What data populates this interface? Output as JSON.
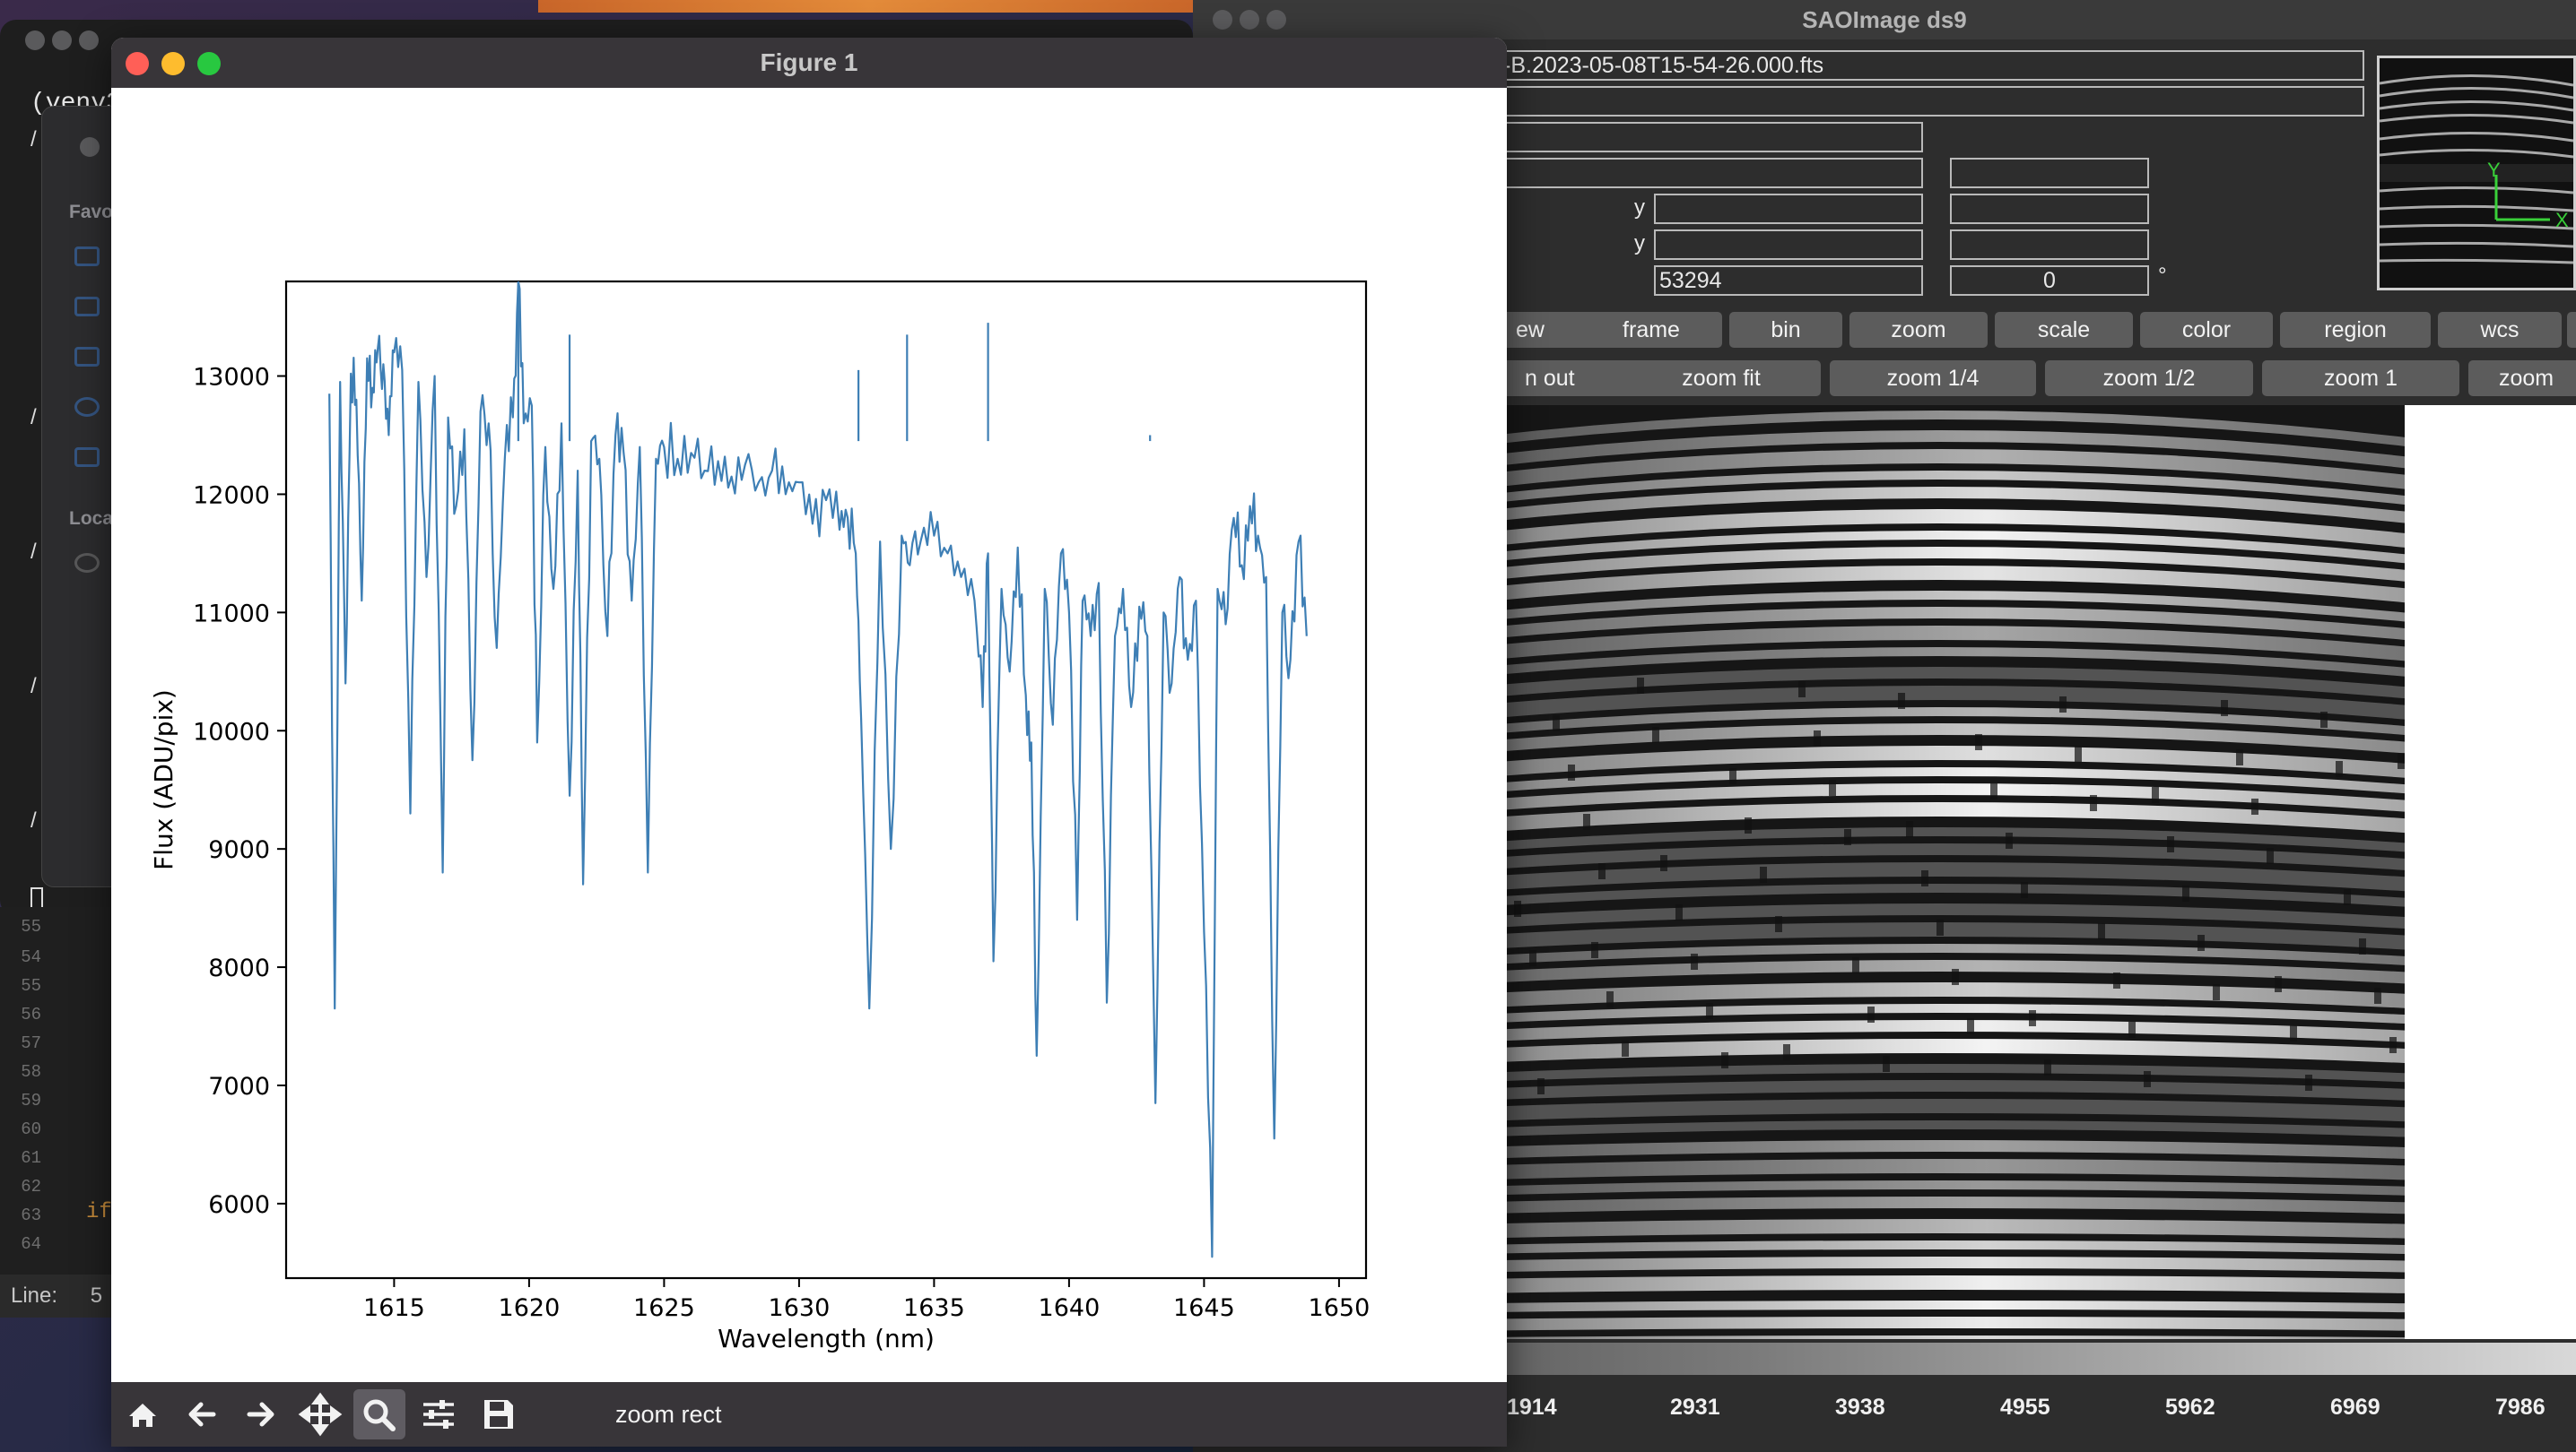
{
  "background_windows": {
    "terminal": {
      "prompt_text": "(venv3",
      "line_marks": [
        "/",
        "/",
        "/",
        "/",
        "/"
      ]
    },
    "finder_sidebar": {
      "favorites_label": "Favo",
      "locations_label": "Loca"
    },
    "editor": {
      "line_numbers": [
        "55",
        "54",
        "55",
        "56",
        "57",
        "58",
        "59",
        "60",
        "61",
        "62",
        "63",
        "64"
      ],
      "code_text": "if",
      "status_label": "Line:",
      "status_value": "5"
    }
  },
  "ds9": {
    "title": "SAOImage ds9",
    "file_name": "-B.2023-05-08T15-54-26.000.fts",
    "info_fields": {
      "value_field": "53294",
      "angle_value": "0",
      "y_label_1": "y",
      "y_label_2": "y",
      "degree_symbol": "°"
    },
    "menu_buttons": [
      "ew",
      "frame",
      "bin",
      "zoom",
      "scale",
      "color",
      "region",
      "wcs"
    ],
    "zoom_buttons": [
      "n out",
      "zoom fit",
      "zoom 1/4",
      "zoom 1/2",
      "zoom 1",
      "zoom"
    ],
    "colorbar_ticks": [
      "1914",
      "2931",
      "3938",
      "4955",
      "5962",
      "6969",
      "7986"
    ],
    "colors": {
      "panel_bg": "#2d2d2d",
      "button_bg": "#5c5c5c"
    }
  },
  "figure": {
    "title": "Figure 1",
    "toolbar": {
      "status_text": "zoom rect",
      "icons": [
        "home-icon",
        "back-arrow-icon",
        "forward-arrow-icon",
        "pan-icon",
        "zoom-magnifier-icon",
        "configure-subplots-icon",
        "save-icon"
      ]
    }
  },
  "chart_data": {
    "type": "line",
    "title": "",
    "xlabel": "Wavelength (nm)",
    "ylabel": "Flux (ADU/pix)",
    "xlim": [
      1611.0,
      1651.0
    ],
    "ylim": [
      5370,
      13800
    ],
    "xticks": [
      1615,
      1620,
      1625,
      1630,
      1635,
      1640,
      1645,
      1650
    ],
    "xtick_labels": [
      "1615",
      "1620",
      "1625",
      "1630",
      "1635",
      "1640",
      "1645",
      "1650"
    ],
    "yticks": [
      6000,
      7000,
      8000,
      9000,
      10000,
      11000,
      12000,
      13000
    ],
    "ytick_labels": [
      "6000",
      "7000",
      "8000",
      "9000",
      "10000",
      "11000",
      "12000",
      "13000"
    ],
    "line_color": "#3e7fb5",
    "series": [
      {
        "x": [
          1612.6,
          1612.8,
          1613.0,
          1613.2,
          1613.4,
          1613.6,
          1613.8,
          1614.0,
          1614.2,
          1614.4,
          1614.6,
          1614.8,
          1615.0,
          1615.3,
          1615.6,
          1615.9,
          1616.2,
          1616.5,
          1616.8,
          1617.0,
          1617.3,
          1617.6,
          1617.9,
          1618.2,
          1618.5,
          1618.8,
          1619.1,
          1619.4,
          1619.6,
          1619.8,
          1620.1,
          1620.3,
          1620.6,
          1620.9,
          1621.2,
          1621.5,
          1621.8,
          1622.0,
          1622.3,
          1622.6,
          1622.9,
          1623.2,
          1623.5,
          1623.8,
          1624.1,
          1624.4,
          1624.7,
          1625.0,
          1625.5,
          1626.0,
          1626.5,
          1627.0,
          1627.5,
          1628.0,
          1628.5,
          1629.0,
          1629.5,
          1630.0,
          1630.5,
          1631.0,
          1631.5,
          1631.8,
          1632.1,
          1632.3,
          1632.6,
          1633.0,
          1633.4,
          1633.8,
          1634.1,
          1634.5,
          1635.0,
          1635.5,
          1636.0,
          1636.5,
          1636.8,
          1637.0,
          1637.2,
          1637.5,
          1637.8,
          1638.1,
          1638.4,
          1638.6,
          1638.8,
          1639.1,
          1639.4,
          1639.7,
          1640.0,
          1640.3,
          1640.5,
          1640.8,
          1641.1,
          1641.4,
          1641.7,
          1642.0,
          1642.3,
          1642.6,
          1642.9,
          1643.2,
          1643.5,
          1643.8,
          1644.1,
          1644.4,
          1644.7,
          1645.0,
          1645.3,
          1645.5,
          1645.8,
          1646.1,
          1646.4,
          1646.7,
          1647.0,
          1647.3,
          1647.6,
          1647.9,
          1648.2,
          1648.5,
          1648.8
        ],
        "y": [
          12850,
          7650,
          12950,
          10400,
          13020,
          12800,
          11100,
          13150,
          12900,
          13240,
          13100,
          12500,
          13200,
          13050,
          9300,
          12950,
          11300,
          13000,
          8800,
          12650,
          11900,
          12550,
          9750,
          12700,
          12600,
          10700,
          12300,
          12650,
          13800,
          12600,
          12750,
          9900,
          12400,
          11200,
          12600,
          9450,
          12200,
          8700,
          12450,
          12300,
          10800,
          12500,
          12350,
          11100,
          12400,
          8800,
          12300,
          12400,
          12300,
          12350,
          12200,
          12280,
          12150,
          12250,
          12100,
          12200,
          12000,
          12100,
          11750,
          11950,
          11700,
          11800,
          11500,
          10100,
          7650,
          11600,
          9000,
          11650,
          11400,
          11600,
          11650,
          11500,
          11300,
          11100,
          10200,
          11500,
          8050,
          11200,
          10500,
          11550,
          10300,
          9900,
          7250,
          11200,
          10050,
          11500,
          11000,
          8400,
          11100,
          10800,
          11250,
          7700,
          10800,
          11200,
          10200,
          11050,
          10800,
          6850,
          11000,
          10400,
          11300,
          10600,
          11100,
          8300,
          5550,
          11200,
          10900,
          11800,
          11400,
          11900,
          11650,
          11300,
          6550,
          11000,
          10600,
          11600,
          10800
        ]
      }
    ],
    "spikes": [
      {
        "x": 1619.6,
        "y": 13800
      },
      {
        "x": 1621.5,
        "y": 13350
      },
      {
        "x": 1632.2,
        "y": 13050
      },
      {
        "x": 1634.0,
        "y": 13350
      },
      {
        "x": 1637.0,
        "y": 13450
      },
      {
        "x": 1643.0,
        "y": 12500
      }
    ]
  }
}
